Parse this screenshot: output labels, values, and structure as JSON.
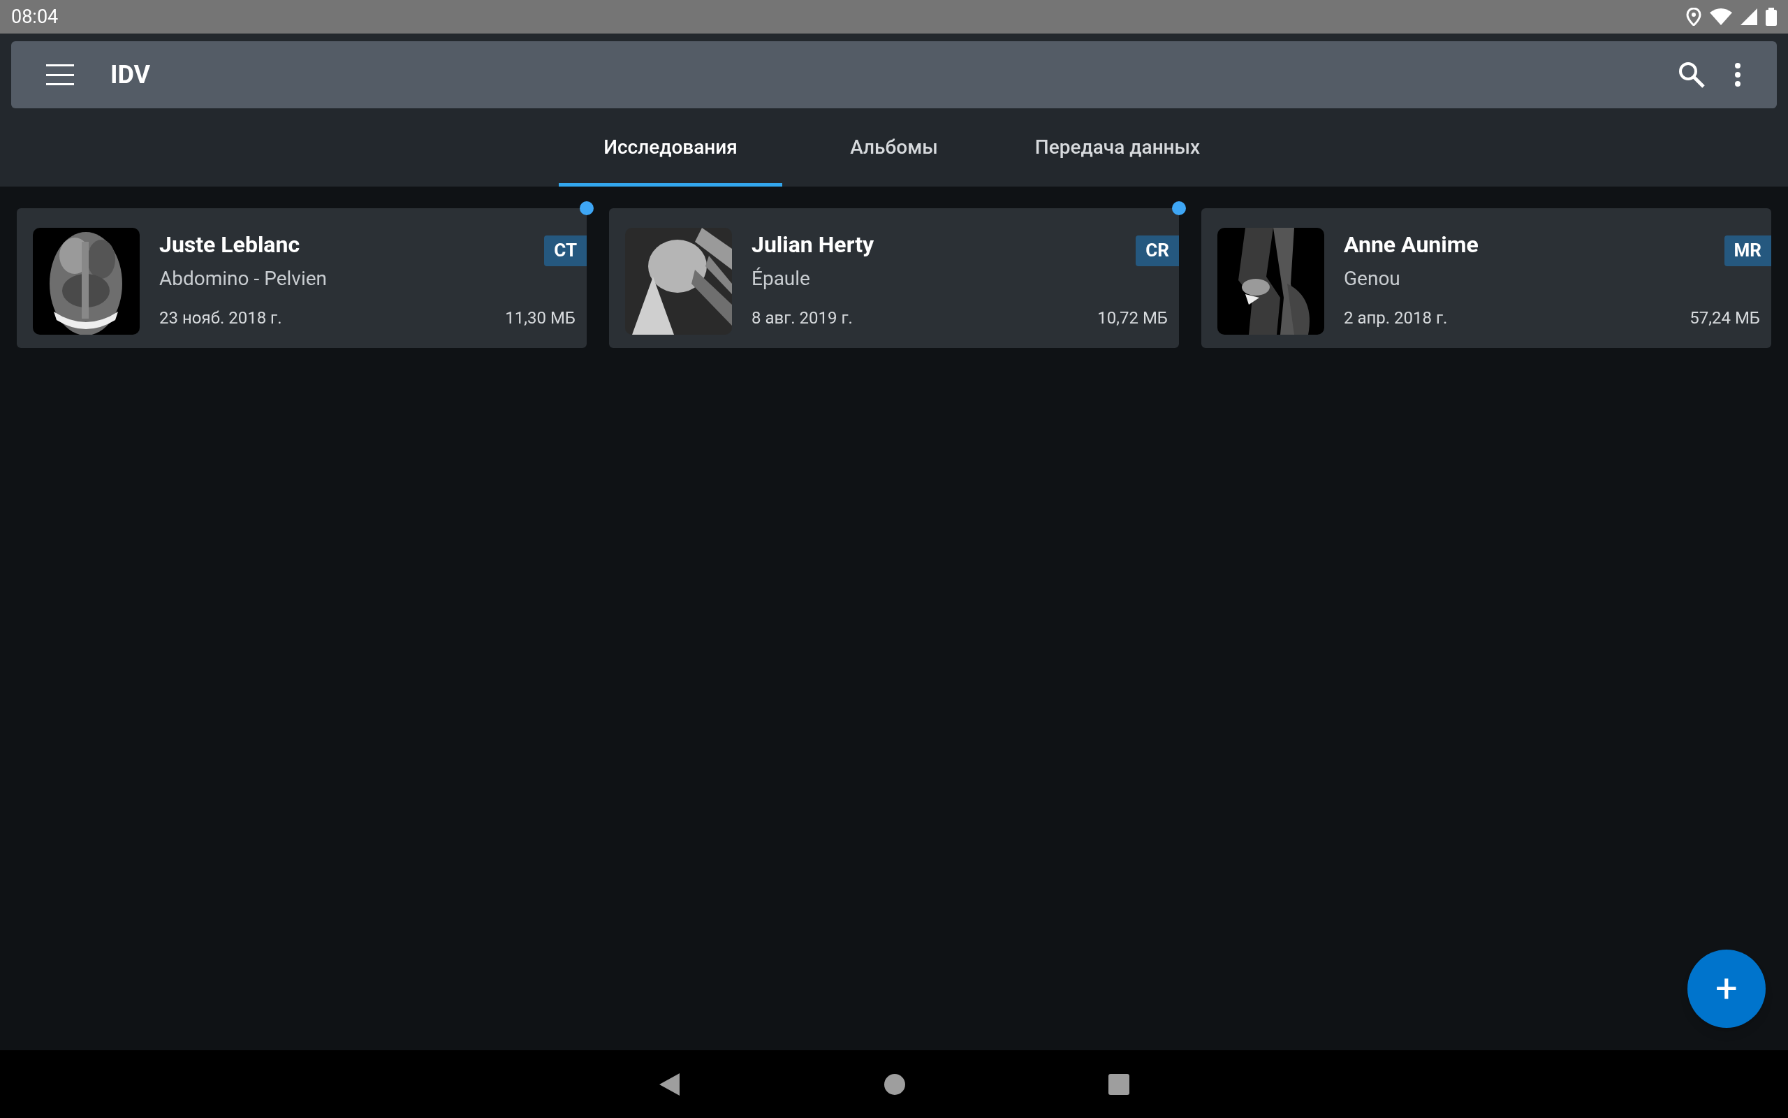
{
  "status_bar": {
    "time": "08:04"
  },
  "toolbar": {
    "title": "IDV"
  },
  "tabs": [
    {
      "label": "Исследования",
      "selected": true
    },
    {
      "label": "Альбомы",
      "selected": false
    },
    {
      "label": "Передача данных",
      "selected": false
    }
  ],
  "studies": [
    {
      "name": "Juste Leblanc",
      "description": "Abdomino - Pelvien",
      "date": "23 нояб. 2018 г.",
      "size": "11,30 МБ",
      "modality": "CT",
      "unread": true
    },
    {
      "name": "Julian Herty",
      "description": "Épaule",
      "date": "8 авг. 2019 г.",
      "size": "10,72 МБ",
      "modality": "CR",
      "unread": true
    },
    {
      "name": "Anne Aunime",
      "description": "Genou",
      "date": "2 апр. 2018 г.",
      "size": "57,24 МБ",
      "modality": "MR",
      "unread": false
    }
  ],
  "fab": {
    "label": "+"
  }
}
